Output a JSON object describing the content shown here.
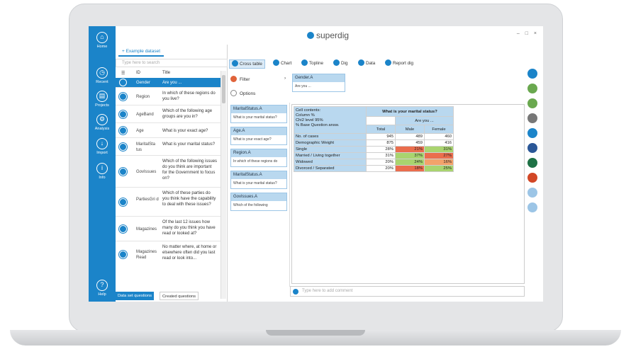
{
  "app": {
    "name": "superdig",
    "window_controls": "– □ ×"
  },
  "nav": [
    {
      "label": "Home",
      "glyph": "⌂"
    },
    {
      "label": "Recent",
      "glyph": "◷"
    },
    {
      "label": "Projects",
      "glyph": "▤"
    },
    {
      "label": "Analysis",
      "glyph": "⚙"
    },
    {
      "label": "Import",
      "glyph": "↓"
    },
    {
      "label": "Info",
      "glyph": "i"
    },
    {
      "label": "Help",
      "glyph": "?"
    }
  ],
  "dataset": {
    "tab_label": "+ Example dataset",
    "search_placeholder": "Type here to search"
  },
  "question_list": {
    "headers": {
      "id": "ID",
      "text": "Title"
    },
    "rows": [
      {
        "id": "Gender",
        "text": "Are you ..."
      },
      {
        "id": "Region",
        "text": "In which of these regions do you live?"
      },
      {
        "id": "AgeBand",
        "text": "Which of the following age groups are you in?"
      },
      {
        "id": "Age",
        "text": "What is your exact age?"
      },
      {
        "id": "MaritalSta tus",
        "text": "What is your marital status?"
      },
      {
        "id": "GovIssues",
        "text": "Which of the following issues do you think are important for the Government to focus on?"
      },
      {
        "id": "PartiesGri d",
        "text": "Which of these parties do you think have the capability to deal with these issues?"
      },
      {
        "id": "Magazines",
        "text": "Of the last 12 issues how many do you think you have read or looked at?"
      },
      {
        "id": "Magazines Read",
        "text": "No matter where, at home or elsewhere often did you last read or look into..."
      }
    ]
  },
  "bottom_tabs": {
    "active": "Data set questions",
    "inactive": "Created questions"
  },
  "toolbar": [
    {
      "label": "Cross table",
      "active": true
    },
    {
      "label": "Chart",
      "active": false
    },
    {
      "label": "Topline",
      "active": false
    },
    {
      "label": "Dig",
      "active": false
    },
    {
      "label": "Data",
      "active": false
    },
    {
      "label": "Report dig",
      "active": false
    }
  ],
  "filters": {
    "filter": "Filter",
    "options": "Options"
  },
  "top_variable": {
    "name": "Gender.A",
    "text": "Are you ..."
  },
  "side_variables": [
    {
      "name": "MaritalStatus.A",
      "text": "What is your marital status?"
    },
    {
      "name": "Age.A",
      "text": "What is your exact age?"
    },
    {
      "name": "Region.A",
      "text": "In which of these regions do"
    },
    {
      "name": "MaritalStatus.A",
      "text": "What is your marital status?"
    },
    {
      "name": "GovIssues.A",
      "text": "Which of the following"
    }
  ],
  "cross_table": {
    "cell_contents": [
      "Cell contents:",
      "Column %",
      "Chi2 level 95%",
      "% Base Question answ."
    ],
    "title": "What is your marital status?",
    "sub": "Are you ...",
    "columns": [
      "Total",
      "Male",
      "Female"
    ],
    "rows": [
      {
        "label": "No. of cases",
        "values": [
          "945",
          "489",
          "460"
        ]
      },
      {
        "label": "Demographic Weight",
        "values": [
          "875",
          "459",
          "416"
        ]
      },
      {
        "label": "Single",
        "values": [
          "28%",
          "21%",
          "31%"
        ]
      },
      {
        "label": "Married / Living together",
        "values": [
          "31%",
          "37%",
          "27%"
        ]
      },
      {
        "label": "Widowed",
        "values": [
          "20%",
          "24%",
          "16%"
        ]
      },
      {
        "label": "Divorced / Separated",
        "values": [
          "20%",
          "18%",
          "25%"
        ]
      }
    ]
  },
  "comment": {
    "placeholder": "Type here to add comment"
  },
  "rail_colors": [
    "#1b84c9",
    "#6aa84f",
    "#6aa84f",
    "#777777",
    "#1b84c9",
    "#2b5797",
    "#1e7145",
    "#d24726",
    "#9cc5e6",
    "#9cc5e6"
  ]
}
